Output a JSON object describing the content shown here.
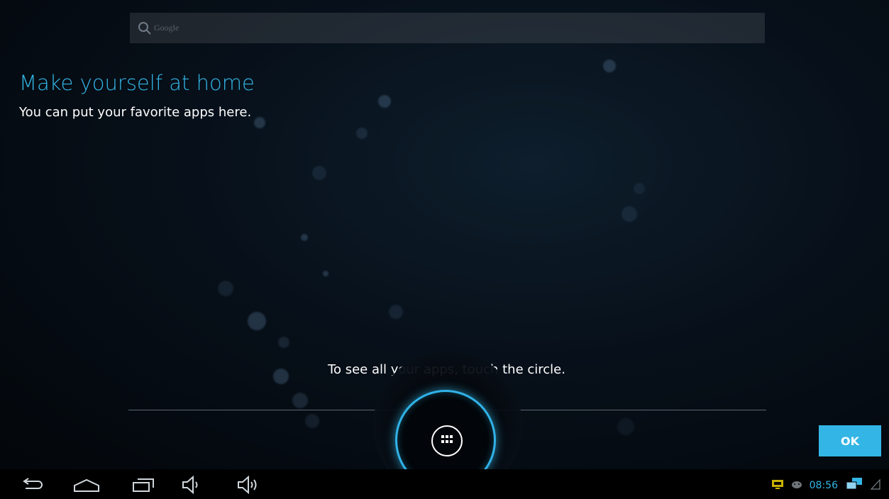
{
  "search": {
    "placeholder": "Google",
    "icon": "search-icon"
  },
  "cling": {
    "title": "Make yourself at home",
    "subtitle": "You can put your favorite apps here.",
    "hint": "To see all your apps, touch the circle.",
    "ok_label": "OK"
  },
  "all_apps": {
    "icon": "all-apps-grid-icon"
  },
  "navigation": {
    "buttons": [
      "back-icon",
      "home-icon",
      "recent-apps-icon",
      "volume-down-icon",
      "volume-up-icon"
    ]
  },
  "status_bar": {
    "time": "08:56",
    "icons": [
      "screen-share-icon",
      "android-debug-icon",
      "network-icon",
      "signal-icon"
    ]
  },
  "colors": {
    "accent": "#33b5e5",
    "background": "#050608",
    "text": "#ffffff",
    "debug_icon": "#c9b200"
  }
}
